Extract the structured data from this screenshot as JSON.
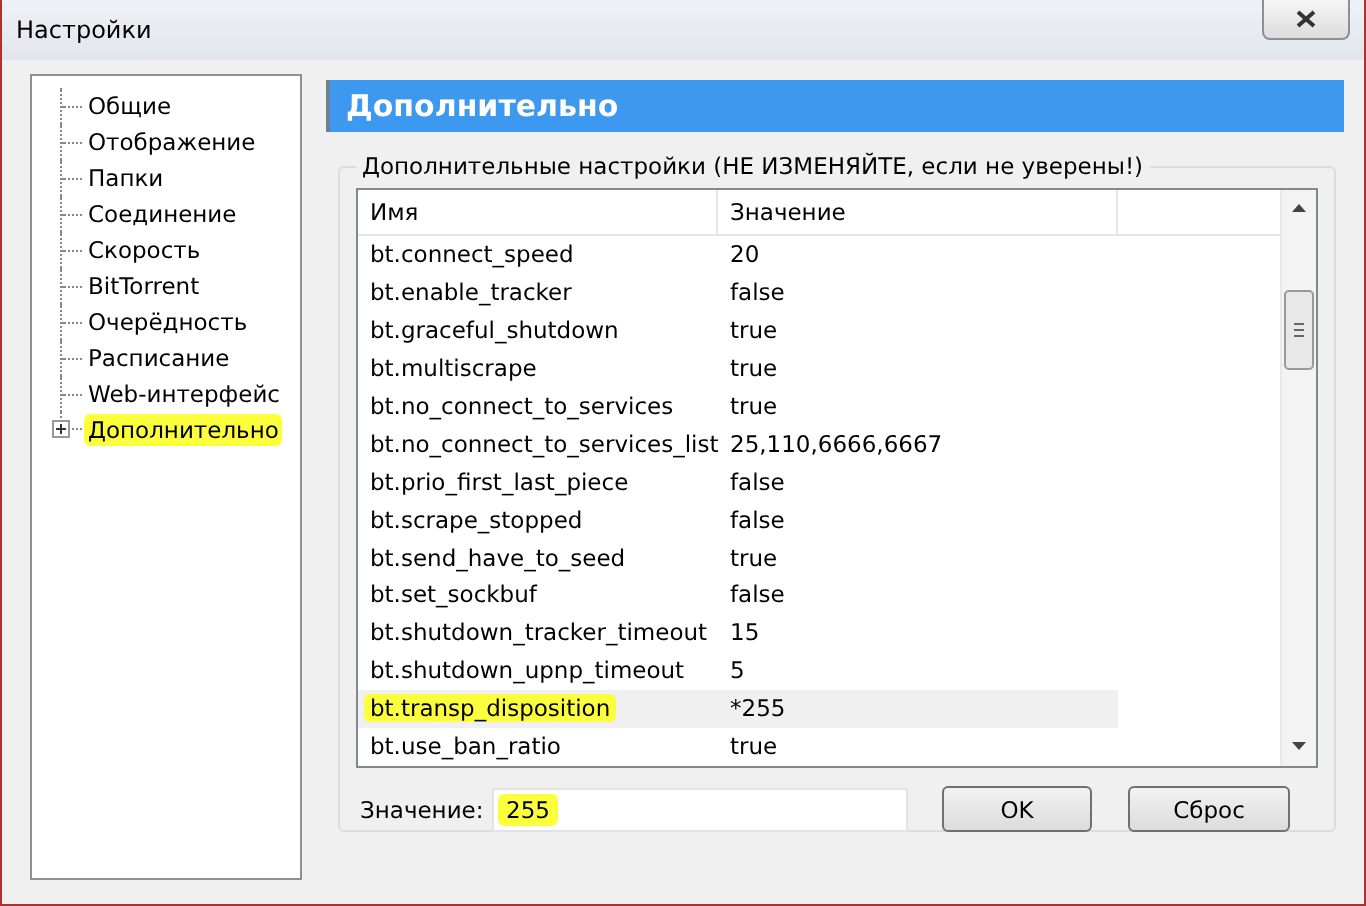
{
  "window": {
    "title": "Настройки"
  },
  "sidebar": {
    "items": [
      {
        "label": "Общие",
        "kind": "leaf",
        "selected": false
      },
      {
        "label": "Отображение",
        "kind": "leaf",
        "selected": false
      },
      {
        "label": "Папки",
        "kind": "leaf",
        "selected": false
      },
      {
        "label": "Соединение",
        "kind": "leaf",
        "selected": false
      },
      {
        "label": "Скорость",
        "kind": "leaf",
        "selected": false
      },
      {
        "label": "BitTorrent",
        "kind": "leaf",
        "selected": false
      },
      {
        "label": "Очерёдность",
        "kind": "leaf",
        "selected": false
      },
      {
        "label": "Расписание",
        "kind": "leaf",
        "selected": false
      },
      {
        "label": "Web-интерфейс",
        "kind": "leaf",
        "selected": false
      },
      {
        "label": "Дополнительно",
        "kind": "expandable",
        "selected": true
      }
    ]
  },
  "header": {
    "title": "Дополнительно"
  },
  "group": {
    "title": "Дополнительные настройки (НЕ ИЗМЕНЯЙТЕ, если не уверены!)"
  },
  "table": {
    "columns": [
      "Имя",
      "Значение"
    ],
    "rows": [
      {
        "name": "bt.connect_speed",
        "value": "20",
        "selected": false
      },
      {
        "name": "bt.enable_tracker",
        "value": "false",
        "selected": false
      },
      {
        "name": "bt.graceful_shutdown",
        "value": "true",
        "selected": false
      },
      {
        "name": "bt.multiscrape",
        "value": "true",
        "selected": false
      },
      {
        "name": "bt.no_connect_to_services",
        "value": "true",
        "selected": false
      },
      {
        "name": "bt.no_connect_to_services_list",
        "value": "25,110,6666,6667",
        "selected": false
      },
      {
        "name": "bt.prio_first_last_piece",
        "value": "false",
        "selected": false
      },
      {
        "name": "bt.scrape_stopped",
        "value": "false",
        "selected": false
      },
      {
        "name": "bt.send_have_to_seed",
        "value": "true",
        "selected": false
      },
      {
        "name": "bt.set_sockbuf",
        "value": "false",
        "selected": false
      },
      {
        "name": "bt.shutdown_tracker_timeout",
        "value": "15",
        "selected": false
      },
      {
        "name": "bt.shutdown_upnp_timeout",
        "value": "5",
        "selected": false
      },
      {
        "name": "bt.transp_disposition",
        "value": "*255",
        "selected": true
      },
      {
        "name": "bt.use_ban_ratio",
        "value": "true",
        "selected": false
      }
    ]
  },
  "value_field": {
    "label": "Значение:",
    "value": "255",
    "highlighted": true
  },
  "buttons": [
    {
      "label": "OK"
    },
    {
      "label": "Сброс"
    }
  ]
}
